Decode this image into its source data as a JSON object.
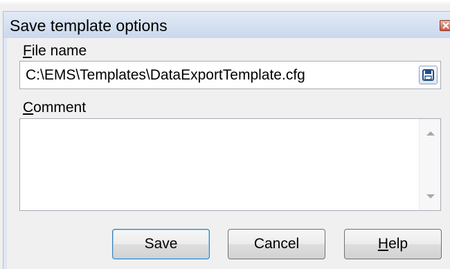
{
  "window": {
    "title": "Save template options"
  },
  "file_name": {
    "label_mnemonic": "F",
    "label_rest": "ile name",
    "value": "C:\\EMS\\Templates\\DataExportTemplate.cfg"
  },
  "comment": {
    "label_mnemonic": "C",
    "label_rest": "omment",
    "value": ""
  },
  "buttons": {
    "save": "Save",
    "cancel": "Cancel",
    "help_mnemonic": "H",
    "help_rest": "elp"
  },
  "icons": {
    "close": "close-icon",
    "save_file": "floppy-disk-icon",
    "scroll_up": "scroll-up-arrow-icon",
    "scroll_down": "scroll-down-arrow-icon"
  }
}
